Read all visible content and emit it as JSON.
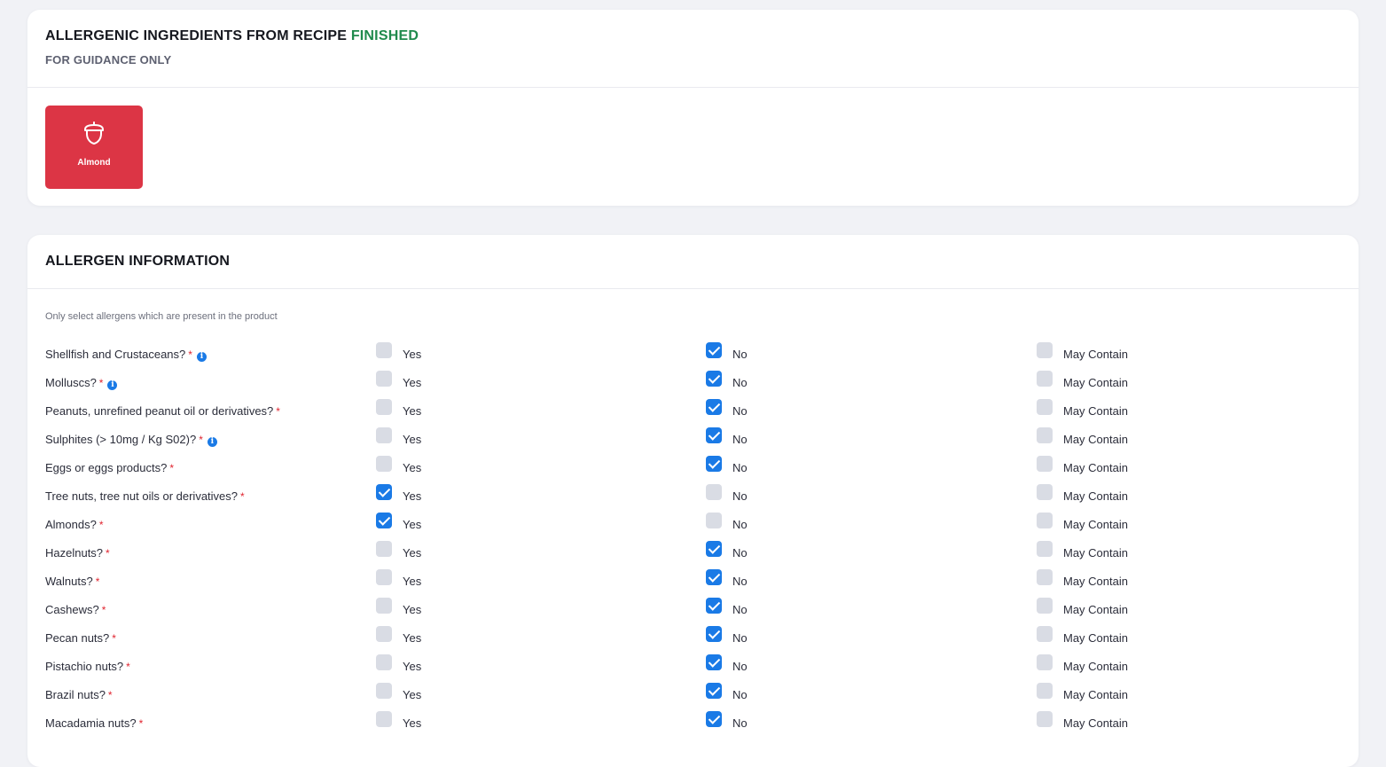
{
  "recipe_card": {
    "title": "ALLERGENIC INGREDIENTS FROM RECIPE",
    "status": "FINISHED",
    "subtitle": "FOR GUIDANCE ONLY",
    "allergen_tiles": [
      {
        "label": "Almond",
        "icon": "acorn-icon",
        "color": "#dc3545"
      }
    ]
  },
  "info_card": {
    "title": "ALLERGEN INFORMATION",
    "hint": "Only select allergens which are present in the product",
    "option_labels": {
      "yes": "Yes",
      "no": "No",
      "may": "May Contain"
    },
    "required_mark": "*",
    "accent_color": "#1a7ae6",
    "questions": [
      {
        "label": "Shellfish and Crustaceans?",
        "info": true,
        "answer": "no"
      },
      {
        "label": "Molluscs?",
        "info": true,
        "answer": "no"
      },
      {
        "label": "Peanuts, unrefined peanut oil or derivatives?",
        "info": false,
        "answer": "no"
      },
      {
        "label": "Sulphites (> 10mg / Kg S02)?",
        "info": true,
        "answer": "no"
      },
      {
        "label": "Eggs or eggs products?",
        "info": false,
        "answer": "no"
      },
      {
        "label": "Tree nuts, tree nut oils or derivatives?",
        "info": false,
        "answer": "yes"
      },
      {
        "label": "Almonds?",
        "info": false,
        "answer": "yes"
      },
      {
        "label": "Hazelnuts?",
        "info": false,
        "answer": "no"
      },
      {
        "label": "Walnuts?",
        "info": false,
        "answer": "no"
      },
      {
        "label": "Cashews?",
        "info": false,
        "answer": "no"
      },
      {
        "label": "Pecan nuts?",
        "info": false,
        "answer": "no"
      },
      {
        "label": "Pistachio nuts?",
        "info": false,
        "answer": "no"
      },
      {
        "label": "Brazil nuts?",
        "info": false,
        "answer": "no"
      },
      {
        "label": "Macadamia nuts?",
        "info": false,
        "answer": "no"
      }
    ]
  }
}
